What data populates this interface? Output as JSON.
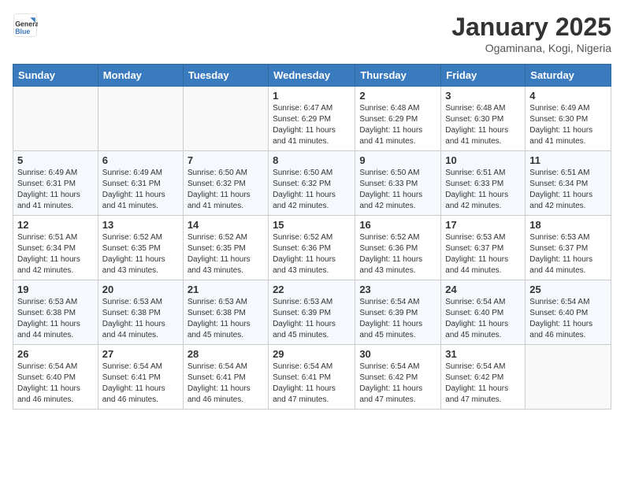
{
  "header": {
    "logo_general": "General",
    "logo_blue": "Blue",
    "title": "January 2025",
    "location": "Ogaminana, Kogi, Nigeria"
  },
  "weekdays": [
    "Sunday",
    "Monday",
    "Tuesday",
    "Wednesday",
    "Thursday",
    "Friday",
    "Saturday"
  ],
  "weeks": [
    [
      {
        "day": "",
        "sunrise": "",
        "sunset": "",
        "daylight": ""
      },
      {
        "day": "",
        "sunrise": "",
        "sunset": "",
        "daylight": ""
      },
      {
        "day": "",
        "sunrise": "",
        "sunset": "",
        "daylight": ""
      },
      {
        "day": "1",
        "sunrise": "Sunrise: 6:47 AM",
        "sunset": "Sunset: 6:29 PM",
        "daylight": "Daylight: 11 hours and 41 minutes."
      },
      {
        "day": "2",
        "sunrise": "Sunrise: 6:48 AM",
        "sunset": "Sunset: 6:29 PM",
        "daylight": "Daylight: 11 hours and 41 minutes."
      },
      {
        "day": "3",
        "sunrise": "Sunrise: 6:48 AM",
        "sunset": "Sunset: 6:30 PM",
        "daylight": "Daylight: 11 hours and 41 minutes."
      },
      {
        "day": "4",
        "sunrise": "Sunrise: 6:49 AM",
        "sunset": "Sunset: 6:30 PM",
        "daylight": "Daylight: 11 hours and 41 minutes."
      }
    ],
    [
      {
        "day": "5",
        "sunrise": "Sunrise: 6:49 AM",
        "sunset": "Sunset: 6:31 PM",
        "daylight": "Daylight: 11 hours and 41 minutes."
      },
      {
        "day": "6",
        "sunrise": "Sunrise: 6:49 AM",
        "sunset": "Sunset: 6:31 PM",
        "daylight": "Daylight: 11 hours and 41 minutes."
      },
      {
        "day": "7",
        "sunrise": "Sunrise: 6:50 AM",
        "sunset": "Sunset: 6:32 PM",
        "daylight": "Daylight: 11 hours and 41 minutes."
      },
      {
        "day": "8",
        "sunrise": "Sunrise: 6:50 AM",
        "sunset": "Sunset: 6:32 PM",
        "daylight": "Daylight: 11 hours and 42 minutes."
      },
      {
        "day": "9",
        "sunrise": "Sunrise: 6:50 AM",
        "sunset": "Sunset: 6:33 PM",
        "daylight": "Daylight: 11 hours and 42 minutes."
      },
      {
        "day": "10",
        "sunrise": "Sunrise: 6:51 AM",
        "sunset": "Sunset: 6:33 PM",
        "daylight": "Daylight: 11 hours and 42 minutes."
      },
      {
        "day": "11",
        "sunrise": "Sunrise: 6:51 AM",
        "sunset": "Sunset: 6:34 PM",
        "daylight": "Daylight: 11 hours and 42 minutes."
      }
    ],
    [
      {
        "day": "12",
        "sunrise": "Sunrise: 6:51 AM",
        "sunset": "Sunset: 6:34 PM",
        "daylight": "Daylight: 11 hours and 42 minutes."
      },
      {
        "day": "13",
        "sunrise": "Sunrise: 6:52 AM",
        "sunset": "Sunset: 6:35 PM",
        "daylight": "Daylight: 11 hours and 43 minutes."
      },
      {
        "day": "14",
        "sunrise": "Sunrise: 6:52 AM",
        "sunset": "Sunset: 6:35 PM",
        "daylight": "Daylight: 11 hours and 43 minutes."
      },
      {
        "day": "15",
        "sunrise": "Sunrise: 6:52 AM",
        "sunset": "Sunset: 6:36 PM",
        "daylight": "Daylight: 11 hours and 43 minutes."
      },
      {
        "day": "16",
        "sunrise": "Sunrise: 6:52 AM",
        "sunset": "Sunset: 6:36 PM",
        "daylight": "Daylight: 11 hours and 43 minutes."
      },
      {
        "day": "17",
        "sunrise": "Sunrise: 6:53 AM",
        "sunset": "Sunset: 6:37 PM",
        "daylight": "Daylight: 11 hours and 44 minutes."
      },
      {
        "day": "18",
        "sunrise": "Sunrise: 6:53 AM",
        "sunset": "Sunset: 6:37 PM",
        "daylight": "Daylight: 11 hours and 44 minutes."
      }
    ],
    [
      {
        "day": "19",
        "sunrise": "Sunrise: 6:53 AM",
        "sunset": "Sunset: 6:38 PM",
        "daylight": "Daylight: 11 hours and 44 minutes."
      },
      {
        "day": "20",
        "sunrise": "Sunrise: 6:53 AM",
        "sunset": "Sunset: 6:38 PM",
        "daylight": "Daylight: 11 hours and 44 minutes."
      },
      {
        "day": "21",
        "sunrise": "Sunrise: 6:53 AM",
        "sunset": "Sunset: 6:38 PM",
        "daylight": "Daylight: 11 hours and 45 minutes."
      },
      {
        "day": "22",
        "sunrise": "Sunrise: 6:53 AM",
        "sunset": "Sunset: 6:39 PM",
        "daylight": "Daylight: 11 hours and 45 minutes."
      },
      {
        "day": "23",
        "sunrise": "Sunrise: 6:54 AM",
        "sunset": "Sunset: 6:39 PM",
        "daylight": "Daylight: 11 hours and 45 minutes."
      },
      {
        "day": "24",
        "sunrise": "Sunrise: 6:54 AM",
        "sunset": "Sunset: 6:40 PM",
        "daylight": "Daylight: 11 hours and 45 minutes."
      },
      {
        "day": "25",
        "sunrise": "Sunrise: 6:54 AM",
        "sunset": "Sunset: 6:40 PM",
        "daylight": "Daylight: 11 hours and 46 minutes."
      }
    ],
    [
      {
        "day": "26",
        "sunrise": "Sunrise: 6:54 AM",
        "sunset": "Sunset: 6:40 PM",
        "daylight": "Daylight: 11 hours and 46 minutes."
      },
      {
        "day": "27",
        "sunrise": "Sunrise: 6:54 AM",
        "sunset": "Sunset: 6:41 PM",
        "daylight": "Daylight: 11 hours and 46 minutes."
      },
      {
        "day": "28",
        "sunrise": "Sunrise: 6:54 AM",
        "sunset": "Sunset: 6:41 PM",
        "daylight": "Daylight: 11 hours and 46 minutes."
      },
      {
        "day": "29",
        "sunrise": "Sunrise: 6:54 AM",
        "sunset": "Sunset: 6:41 PM",
        "daylight": "Daylight: 11 hours and 47 minutes."
      },
      {
        "day": "30",
        "sunrise": "Sunrise: 6:54 AM",
        "sunset": "Sunset: 6:42 PM",
        "daylight": "Daylight: 11 hours and 47 minutes."
      },
      {
        "day": "31",
        "sunrise": "Sunrise: 6:54 AM",
        "sunset": "Sunset: 6:42 PM",
        "daylight": "Daylight: 11 hours and 47 minutes."
      },
      {
        "day": "",
        "sunrise": "",
        "sunset": "",
        "daylight": ""
      }
    ]
  ]
}
